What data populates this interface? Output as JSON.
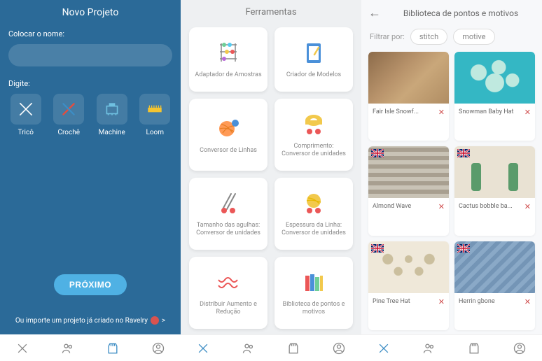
{
  "panel1": {
    "title": "Novo Projeto",
    "name_label": "Colocar o nome:",
    "type_label": "Digite:",
    "crafts": [
      {
        "label": "Tricô"
      },
      {
        "label": "Crochê"
      },
      {
        "label": "Machine"
      },
      {
        "label": "Loom"
      }
    ],
    "next": "PRÓXIMO",
    "import_prefix": "Ou importe um projeto já criado no Ravelry",
    "import_suffix": ">"
  },
  "panel2": {
    "title": "Ferramentas",
    "tools": [
      {
        "label": "Adaptador de Amostras"
      },
      {
        "label": "Criador de Modelos"
      },
      {
        "label": "Conversor de Linhas"
      },
      {
        "label": "Comprimento: Conversor de unidades"
      },
      {
        "label": "Tamanho das agulhas: Conversor de unidades"
      },
      {
        "label": "Espessura da Linha: Conversor de unidades"
      },
      {
        "label": "Distribuir Aumento e Redução"
      },
      {
        "label": "Biblioteca de pontos e motivos"
      }
    ]
  },
  "panel3": {
    "title": "Biblioteca de pontos e motivos",
    "filter_label": "Filtrar por:",
    "chips": [
      "stitch",
      "motive"
    ],
    "items": [
      {
        "label": "Fair Isle Snowf..."
      },
      {
        "label": "Snowman Baby Hat"
      },
      {
        "label": "Almond Wave"
      },
      {
        "label": "Cactus bobble ba..."
      },
      {
        "label": "Pine Tree Hat"
      },
      {
        "label": "Herrin gbone"
      }
    ]
  }
}
